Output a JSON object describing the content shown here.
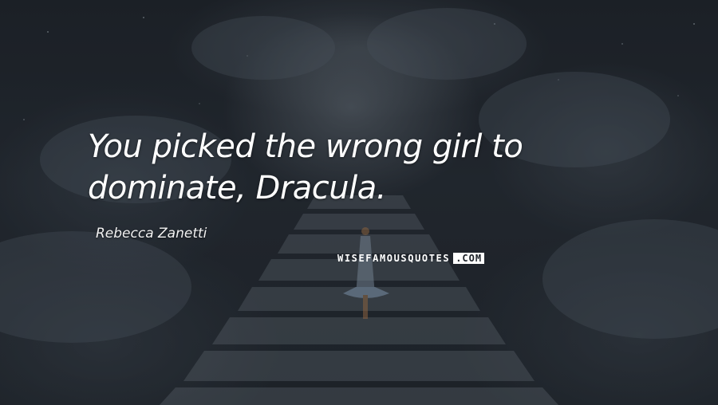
{
  "quote": {
    "text": "You picked the wrong girl to dominate, Dracula.",
    "author": "Rebecca Zanetti"
  },
  "watermark": {
    "brand": "WISEFAMOUSQUOTES",
    "suffix": ".COM"
  },
  "colors": {
    "background": "#1b2027",
    "text": "#ffffff"
  }
}
